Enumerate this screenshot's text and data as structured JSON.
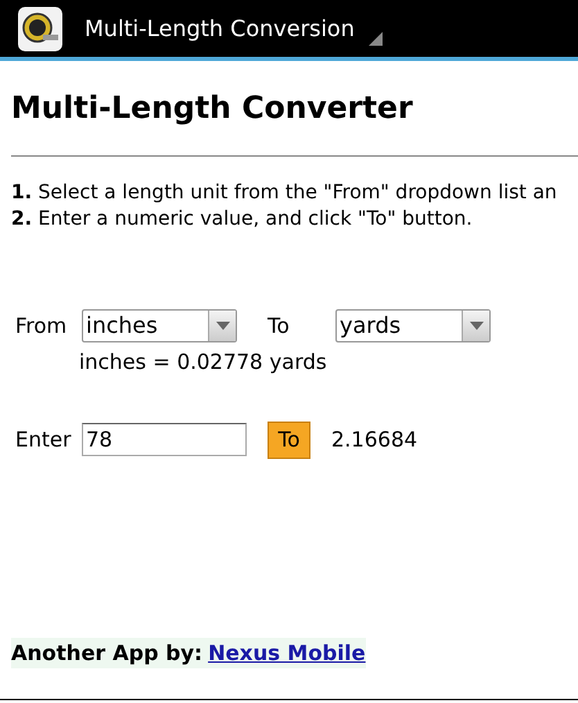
{
  "title_bar": {
    "title": "Multi-Length Conversion"
  },
  "heading": "Multi-Length Converter",
  "instructions": [
    "**1.** Select a length unit from the \"From\" dropdown list an",
    "**2.** Enter a numeric value, and click \"To\" button."
  ],
  "from_label": "From",
  "from_unit": "inches",
  "to_label": "To",
  "to_unit": "yards",
  "ratio": "inches = 0.02778 yards",
  "enter_label": "Enter",
  "input_value": "78",
  "to_button": "To",
  "result": "2.16684",
  "footer": {
    "text": "Another App by:",
    "link": "Nexus Mobile"
  }
}
